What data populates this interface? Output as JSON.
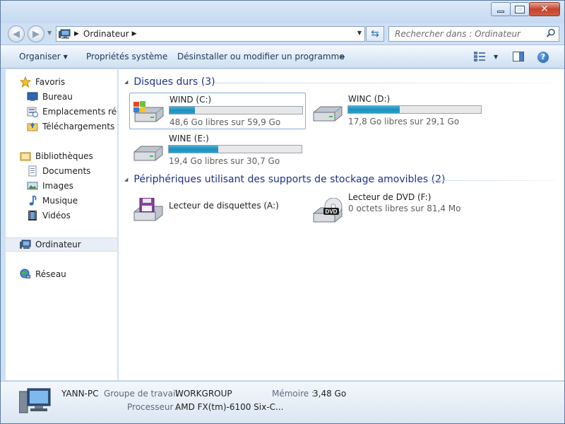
{
  "window": {
    "caption_buttons": {
      "minimize": "minimize",
      "maximize": "maximize",
      "close": "✕"
    }
  },
  "address": {
    "path": "Ordinateur",
    "search_placeholder": "Rechercher dans : Ordinateur"
  },
  "toolbar": {
    "organize": "Organiser",
    "system_properties": "Propriétés système",
    "uninstall": "Désinstaller ou modifier un programme",
    "more": "»"
  },
  "navigation": {
    "favorites": {
      "label": "Favoris",
      "items": [
        "Bureau",
        "Emplacements récents",
        "Téléchargements"
      ]
    },
    "libraries": {
      "label": "Bibliothèques",
      "items": [
        "Documents",
        "Images",
        "Musique",
        "Vidéos"
      ]
    },
    "computer": "Ordinateur",
    "network": "Réseau"
  },
  "content": {
    "hard_drives_header": "Disques durs (3)",
    "removable_header": "Périphériques utilisant des supports de stockage amovibles (2)",
    "drives": [
      {
        "name": "WIND (C:)",
        "free_text": "48,6 Go libres sur 59,9 Go",
        "used_fraction": 0.19,
        "icon": "windows-drive-icon"
      },
      {
        "name": "WINC (D:)",
        "free_text": "17,8 Go libres sur 29,1 Go",
        "used_fraction": 0.39,
        "icon": "hard-drive-icon"
      },
      {
        "name": "WINE (E:)",
        "free_text": "19,4 Go libres sur 30,7 Go",
        "used_fraction": 0.37,
        "icon": "hard-drive-icon"
      }
    ],
    "removable": [
      {
        "name": "Lecteur de disquettes (A:)",
        "free_text": "",
        "icon": "floppy-drive-icon"
      },
      {
        "name": "Lecteur de DVD (F:)",
        "free_text": "0 octets libres sur 81,4 Mo",
        "icon": "dvd-drive-icon"
      }
    ]
  },
  "details": {
    "computer_name": "YANN-PC",
    "workgroup_label": "Groupe de travail :",
    "workgroup_value": "WORKGROUP",
    "memory_label": "Mémoire :",
    "memory_value": "3,48 Go",
    "processor_label": "Processeur :",
    "processor_value": "AMD FX(tm)-6100 Six-C..."
  },
  "colors": {
    "accent_text": "#1e3287",
    "progress_fill": "#1c8fbf",
    "window_frame": "#cfe0f3"
  }
}
